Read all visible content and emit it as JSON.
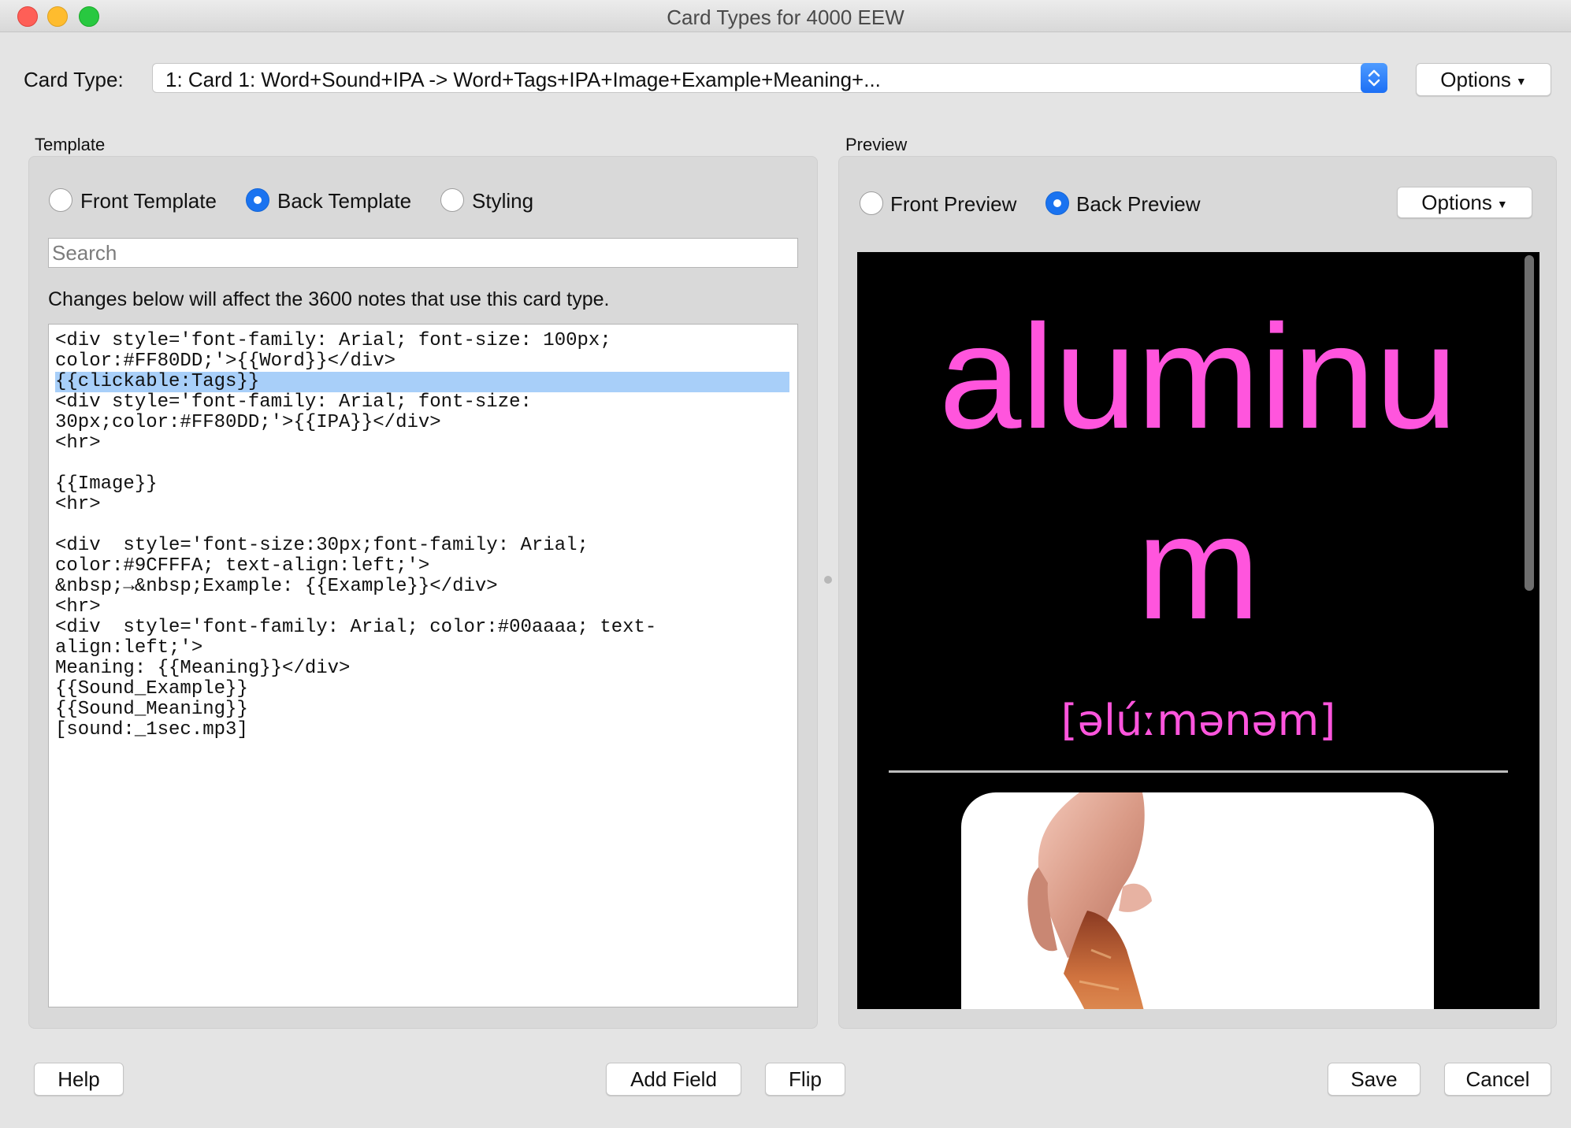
{
  "window": {
    "title": "Card Types for 4000 EEW"
  },
  "card_type": {
    "label": "Card Type:",
    "selected": "1: Card 1: Word+Sound+IPA -> Word+Tags+IPA+Image+Example+Meaning+...",
    "options_button": "Options"
  },
  "template": {
    "section_title": "Template",
    "radios": [
      {
        "label": "Front Template",
        "selected": false
      },
      {
        "label": "Back Template",
        "selected": true
      },
      {
        "label": "Styling",
        "selected": false
      }
    ],
    "search_placeholder": "Search",
    "info": "Changes below will affect the 3600 notes that use this card type.",
    "code_before": "<div style='font-family: Arial; font-size: 100px;\ncolor:#FF80DD;'>{{Word}}</div>\n",
    "code_highlight": "{{clickable:Tags}}",
    "code_after": "<div style='font-family: Arial; font-size:\n30px;color:#FF80DD;'>{{IPA}}</div>\n<hr>\n\n{{Image}}\n<hr>\n\n<div  style='font-size:30px;font-family: Arial;\ncolor:#9CFFFA; text-align:left;'>\n&nbsp;→&nbsp;Example: {{Example}}</div>\n<hr>\n<div  style='font-family: Arial; color:#00aaaa; text-\nalign:left;'>\nMeaning: {{Meaning}}</div>\n{{Sound_Example}}\n{{Sound_Meaning}}\n[sound:_1sec.mp3]"
  },
  "preview": {
    "section_title": "Preview",
    "radios": [
      {
        "label": "Front Preview",
        "selected": false
      },
      {
        "label": "Back Preview",
        "selected": true
      }
    ],
    "options_button": "Options",
    "word_line1": "aluminu",
    "word_line2": "m",
    "ipa": "[əlúːmənəm]",
    "word_color": "#FF55DD"
  },
  "footer": {
    "help": "Help",
    "add_field": "Add Field",
    "flip": "Flip",
    "save": "Save",
    "cancel": "Cancel"
  }
}
